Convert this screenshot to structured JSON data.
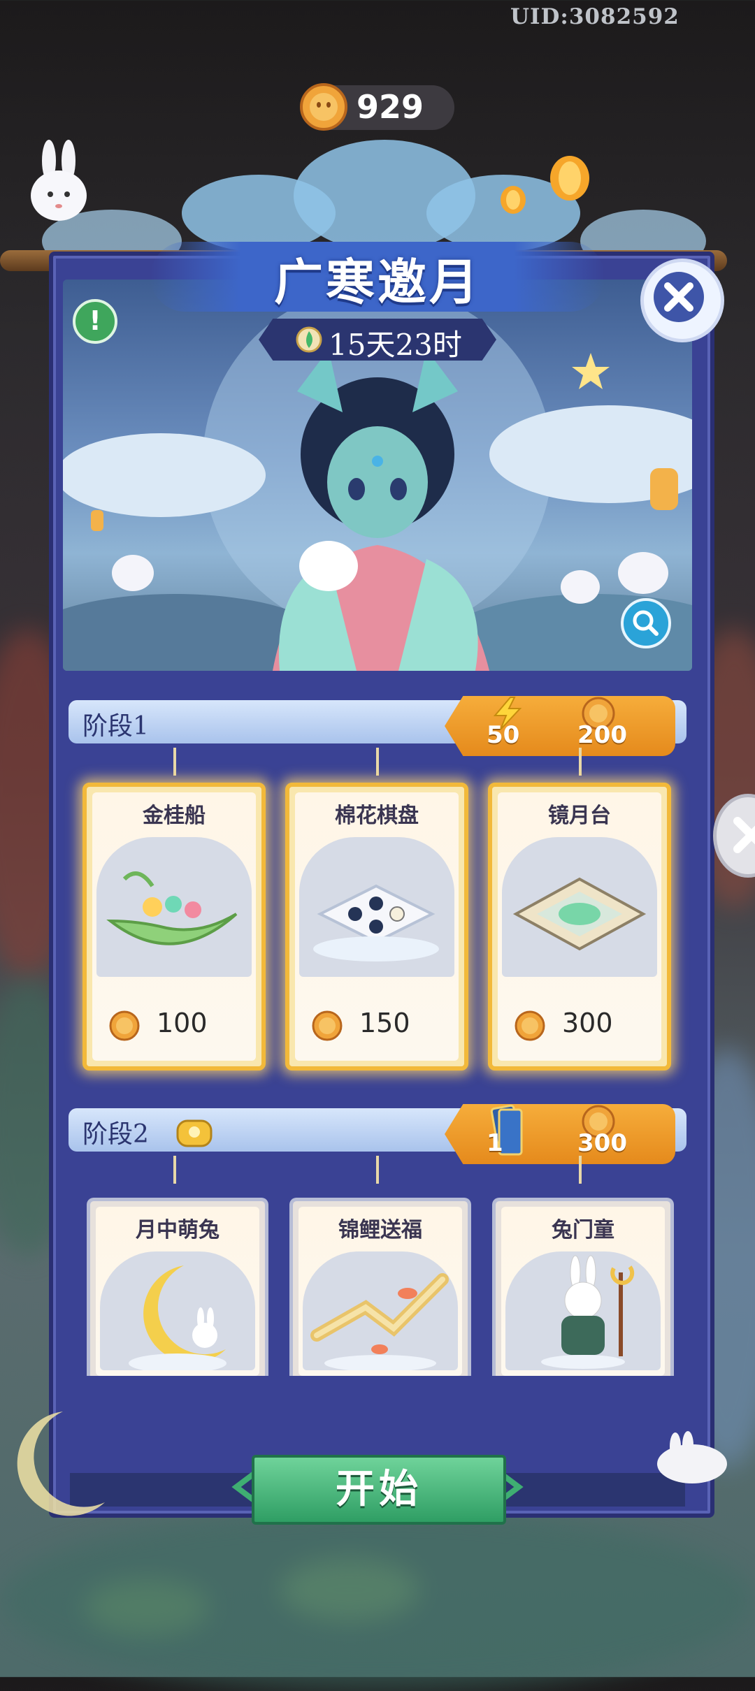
{
  "header": {
    "uid": "UID:3082592",
    "coin_balance": "929"
  },
  "event": {
    "title": "广寒邀月",
    "timer": "15天23时"
  },
  "stages": [
    {
      "label": "阶段1",
      "rewards": [
        {
          "icon": "energy-icon",
          "value": "50"
        },
        {
          "icon": "mooncake-coin-icon",
          "value": "200"
        }
      ],
      "items": [
        {
          "name": "金桂船",
          "price": "100",
          "unlocked": true
        },
        {
          "name": "棉花棋盘",
          "price": "150",
          "unlocked": true
        },
        {
          "name": "镜月台",
          "price": "300",
          "unlocked": true
        }
      ]
    },
    {
      "label": "阶段2",
      "rewards": [
        {
          "icon": "ticket-cards-icon",
          "value": "1"
        },
        {
          "icon": "mooncake-coin-icon",
          "value": "300"
        }
      ],
      "items": [
        {
          "name": "月中萌兔",
          "unlocked": false
        },
        {
          "name": "锦鲤送福",
          "unlocked": false
        },
        {
          "name": "兔门童",
          "unlocked": false
        }
      ]
    }
  ],
  "start_button": "开始",
  "colors": {
    "panel": "#3a4294",
    "accent_orange": "#f0a030",
    "start_green": "#3fae72",
    "gold_glow": "#f2b93a"
  }
}
